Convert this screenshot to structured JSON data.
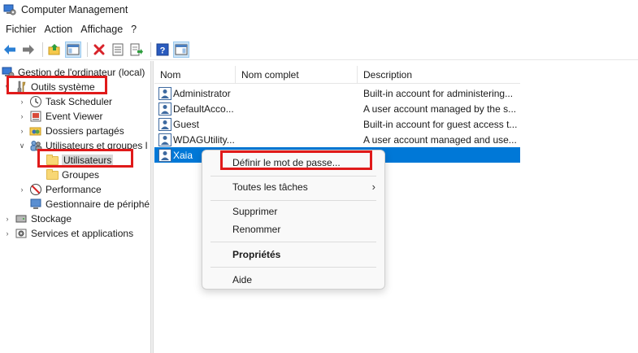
{
  "window": {
    "title": "Computer Management"
  },
  "menu": {
    "items": [
      "Fichier",
      "Action",
      "Affichage",
      "?"
    ]
  },
  "toolbar": {
    "buttons": [
      "back-arrow-icon",
      "forward-arrow-icon",
      "up-folder-icon",
      "show-hide-tree-icon",
      "delete-icon",
      "properties-icon",
      "export-list-icon",
      "help-icon",
      "show-action-pane-icon"
    ]
  },
  "tree": {
    "root": "Gestion de l'ordinateur (local)",
    "outils": "Outils système",
    "task_scheduler": "Task Scheduler",
    "event_viewer": "Event Viewer",
    "dossiers": "Dossiers partagés",
    "utilisateurs_groupes": "Utilisateurs et groupes l",
    "utilisateurs": "Utilisateurs",
    "groupes": "Groupes",
    "performance": "Performance",
    "gestionnaire": "Gestionnaire de périphé",
    "stockage": "Stockage",
    "services": "Services et applications"
  },
  "list": {
    "headers": {
      "nom": "Nom",
      "nom_complet": "Nom complet",
      "description": "Description"
    },
    "rows": [
      {
        "nom": "Administrator",
        "nom_complet": "",
        "description": "Built-in account for administering..."
      },
      {
        "nom": "DefaultAcco...",
        "nom_complet": "",
        "description": "A user account managed by the s..."
      },
      {
        "nom": "Guest",
        "nom_complet": "",
        "description": "Built-in account for guest access t..."
      },
      {
        "nom": "WDAGUtility...",
        "nom_complet": "",
        "description": "A user account managed and use..."
      },
      {
        "nom": "Xaia",
        "nom_complet": "",
        "description": ""
      }
    ]
  },
  "context_menu": {
    "set_password": "Définir le mot de passe...",
    "all_tasks": "Toutes les tâches",
    "delete": "Supprimer",
    "rename": "Renommer",
    "properties": "Propriétés",
    "help": "Aide"
  },
  "colors": {
    "selection": "#0078d7",
    "highlight_box": "#e01a1a",
    "tree_selected": "#d9d9d9"
  }
}
